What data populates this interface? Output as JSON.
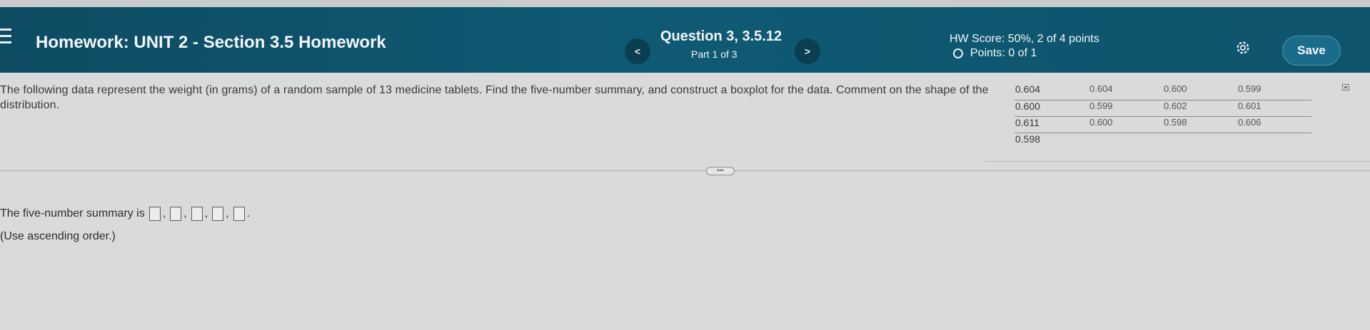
{
  "header": {
    "title": "Homework:  UNIT 2 - Section 3.5 Homework",
    "question_title": "Question 3, 3.5.12",
    "question_part": "Part 1 of 3",
    "prev_label": "<",
    "next_label": ">",
    "hw_score": "HW Score: 50%, 2 of 4 points",
    "points": "Points: 0 of 1",
    "save_label": "Save",
    "colors": {
      "bar": "#0f5a73",
      "save_button": "#1b6c8a"
    }
  },
  "question": {
    "text": "The following data represent the weight (in grams) of a random sample of 13 medicine tablets. Find the five-number summary, and construct a boxplot for the data. Comment on the shape of the distribution.",
    "data_rows": [
      [
        "0.604",
        "0.604",
        "0.600",
        "0.599"
      ],
      [
        "0.600",
        "0.599",
        "0.602",
        "0.601"
      ],
      [
        "0.611",
        "0.600",
        "0.598",
        "0.606"
      ],
      [
        "0.598"
      ]
    ],
    "more_label": "•••"
  },
  "answer": {
    "prompt": "The five-number summary is",
    "separator": ",",
    "end": ".",
    "hint": "(Use ascending order.)",
    "values": [
      "",
      "",
      "",
      "",
      ""
    ]
  },
  "icons": [
    "menu-icon",
    "chevron-left-icon",
    "chevron-right-icon",
    "points-circle-icon",
    "gear-icon",
    "expand-icon"
  ]
}
